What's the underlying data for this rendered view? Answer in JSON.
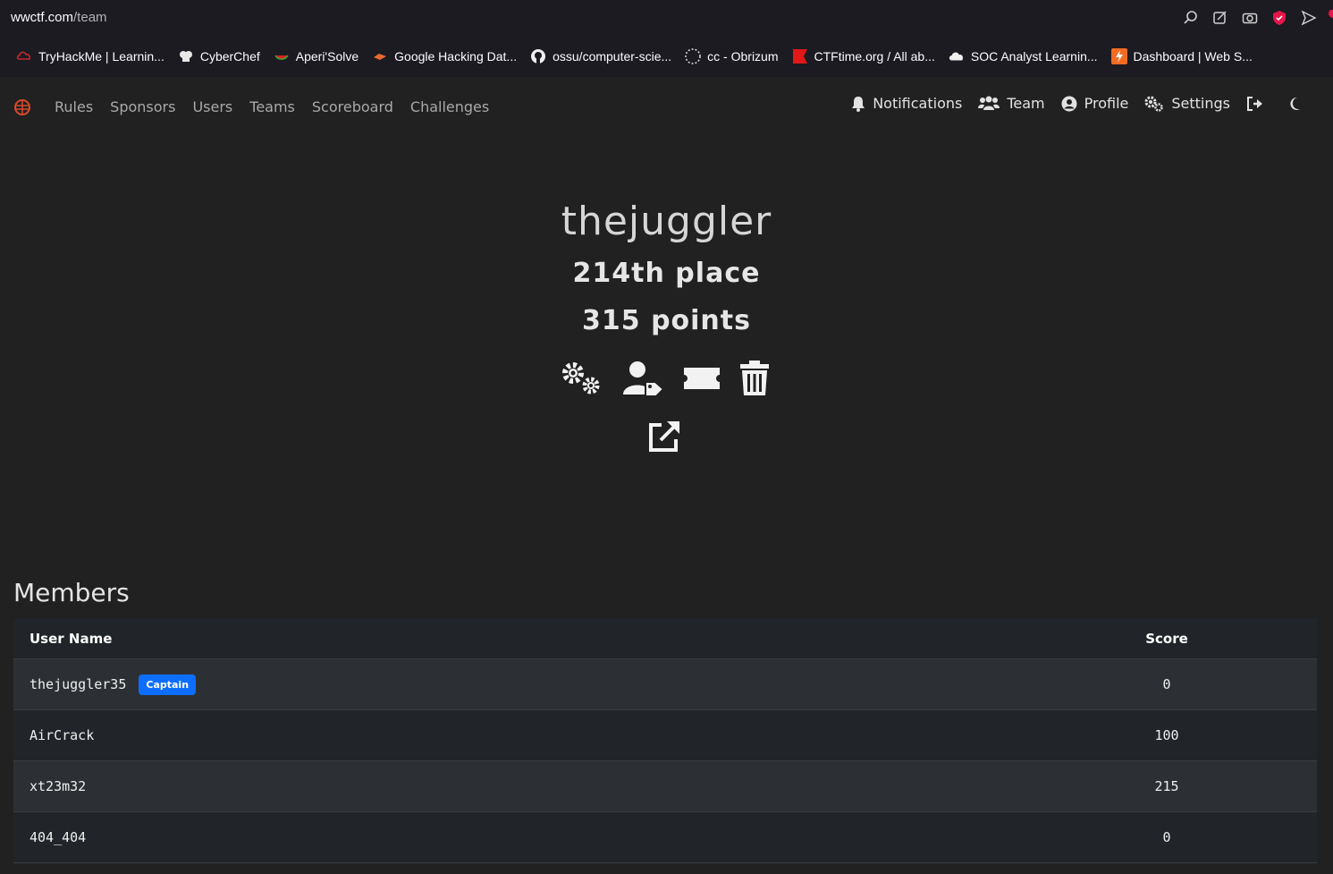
{
  "browser": {
    "url_host": "wwctf.com",
    "url_path": "/team",
    "bookmarks": [
      {
        "label": "TryHackMe | Learnin...",
        "icon": "tryhackme-icon"
      },
      {
        "label": "CyberChef",
        "icon": "chef-hat-icon"
      },
      {
        "label": "Aperi'Solve",
        "icon": "melon-icon"
      },
      {
        "label": "Google Hacking Dat...",
        "icon": "exploitdb-icon"
      },
      {
        "label": "ossu/computer-scie...",
        "icon": "github-icon"
      },
      {
        "label": "cc - Obrizum",
        "icon": "obrizum-icon"
      },
      {
        "label": "CTFtime.org / All ab...",
        "icon": "ctftime-icon"
      },
      {
        "label": "SOC Analyst Learnin...",
        "icon": "cloud-icon"
      },
      {
        "label": "Dashboard | Web S...",
        "icon": "websecurity-icon"
      }
    ]
  },
  "nav": {
    "links": [
      "Rules",
      "Sponsors",
      "Users",
      "Teams",
      "Scoreboard",
      "Challenges"
    ],
    "right": {
      "notifications": "Notifications",
      "team": "Team",
      "profile": "Profile",
      "settings": "Settings"
    }
  },
  "team": {
    "name": "thejuggler",
    "place": "214th place",
    "points": "315 points"
  },
  "members": {
    "title": "Members",
    "headers": {
      "name": "User Name",
      "score": "Score"
    },
    "rows": [
      {
        "name": "thejuggler35",
        "badge": "Captain",
        "score": "0"
      },
      {
        "name": "AirCrack",
        "score": "100"
      },
      {
        "name": "xt23m32",
        "score": "215"
      },
      {
        "name": "404_404",
        "score": "0"
      }
    ]
  },
  "colors": {
    "background": "#212121",
    "badge": "#0d6efd",
    "browser_chrome": "#1c1b22"
  }
}
